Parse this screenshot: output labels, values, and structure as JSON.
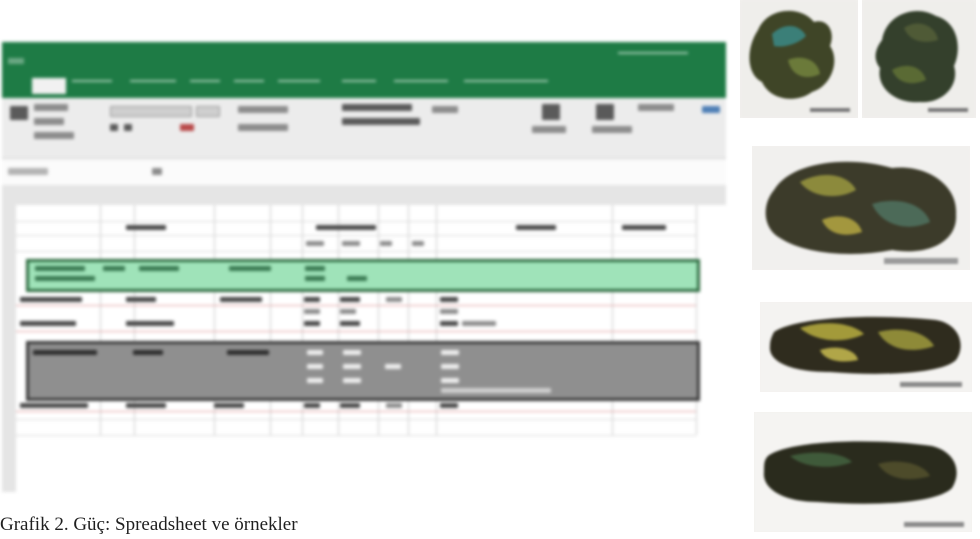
{
  "caption": "Grafik 2. Güç: Spreadsheet ve örnekler",
  "spreadsheet": {
    "ribbon_color": "#1e7b45",
    "active_tab_index": 1,
    "tabs": [
      "",
      "",
      "",
      "",
      "",
      "",
      "",
      "",
      "",
      ""
    ],
    "highlight_green": "#9fe3b9",
    "highlight_gray": "#8f8f8f"
  },
  "specimens": [
    {
      "name": "rock-1"
    },
    {
      "name": "rock-2"
    },
    {
      "name": "rock-3"
    },
    {
      "name": "rock-4"
    },
    {
      "name": "rock-5"
    }
  ]
}
